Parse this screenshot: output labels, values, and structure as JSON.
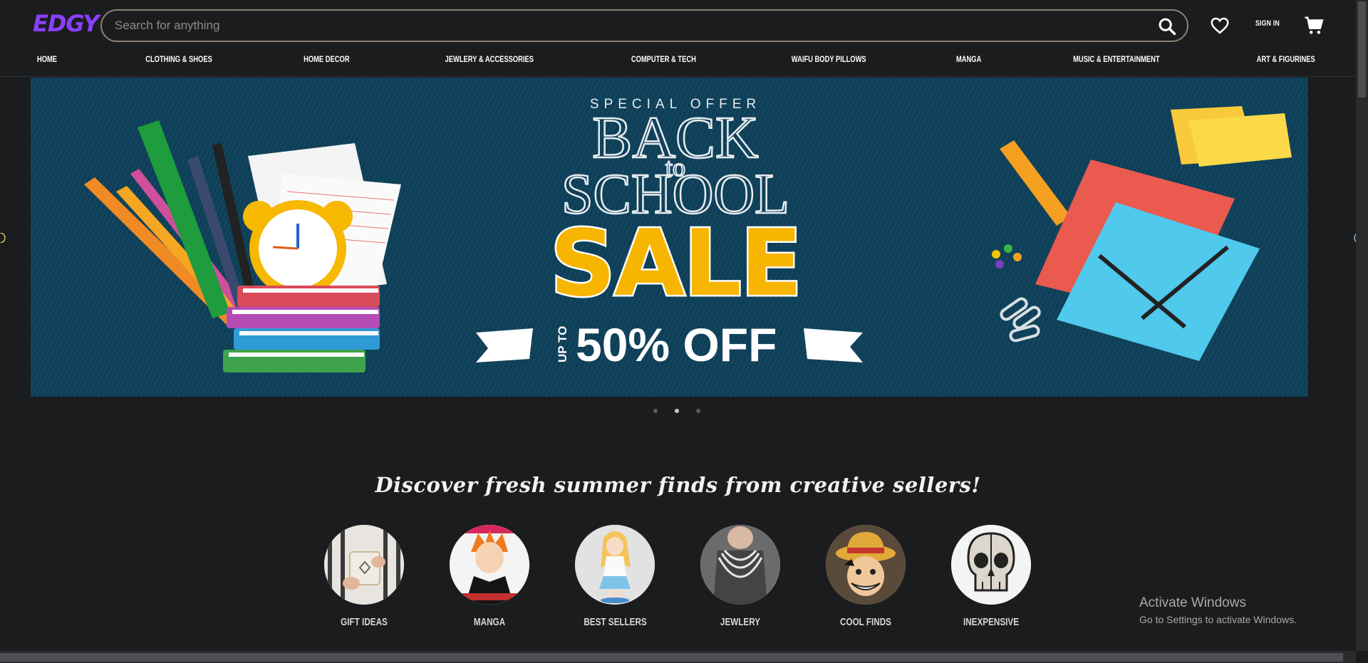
{
  "header": {
    "logo": "EDGY",
    "search_placeholder": "Search for anything",
    "sign_in": "SIGN IN"
  },
  "nav": [
    "HOME",
    "CLOTHING & SHOES",
    "HOME DECOR",
    "JEWLERY & ACCESSORIES",
    "COMPUTER & TECH",
    "WAIFU BODY PILLOWS",
    "MANGA",
    "MUSIC & ENTERTAINMENT",
    "ART & FIGURINES"
  ],
  "banner": {
    "special_offer": "SPECIAL OFFER",
    "back": "BACK",
    "to": "to",
    "school": "SCHOOL",
    "sale": "SALE",
    "up_to": "UP TO",
    "discount": "50% OFF",
    "active_slide": 2,
    "slide_count": 3
  },
  "headline": "Discover fresh summer finds from creative sellers!",
  "categories": [
    {
      "label": "GIFT IDEAS"
    },
    {
      "label": "MANGA"
    },
    {
      "label": "BEST SELLERS"
    },
    {
      "label": "JEWLERY"
    },
    {
      "label": "COOL FINDS"
    },
    {
      "label": "INEXPENSIVE"
    }
  ],
  "watermark": {
    "title": "Activate Windows",
    "subtitle": "Go to Settings to activate Windows."
  },
  "colors": {
    "background": "#1b1c1e",
    "logo": "#8a3ffc",
    "banner": "#0f3d55",
    "sale_yellow": "#f7b500"
  }
}
